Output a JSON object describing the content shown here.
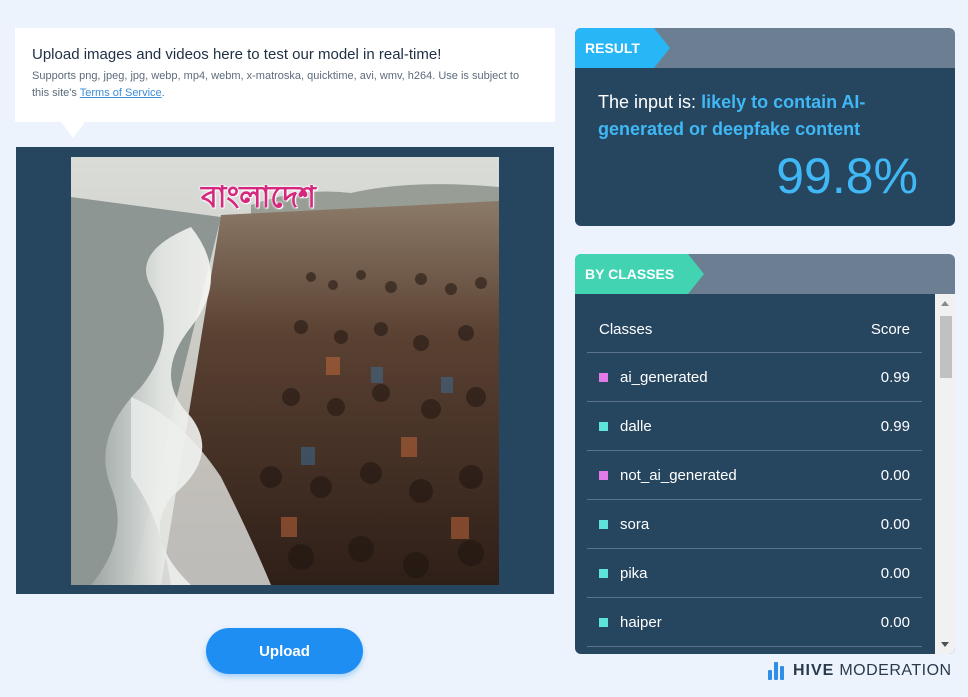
{
  "info": {
    "title": "Upload images and videos here to test our model in real-time!",
    "subtitle_prefix": "Supports png, jpeg, jpg, webp, mp4, webm, x-matroska, quicktime, avi, wmv, h264. Use is subject to this site's ",
    "tos_link": "Terms of Service",
    "subtitle_suffix": "."
  },
  "image": {
    "overlay_text": "বাংলাদেশ"
  },
  "upload_label": "Upload",
  "result": {
    "tag": "RESULT",
    "verdict_prefix": "The input is: ",
    "verdict_highlight": "likely to contain AI-generated or deepfake content",
    "percent": "99.8%"
  },
  "classes": {
    "tag": "BY CLASSES",
    "col_class": "Classes",
    "col_score": "Score",
    "rows": [
      {
        "name": "ai_generated",
        "score": "0.99",
        "color": "#e07be8"
      },
      {
        "name": "dalle",
        "score": "0.99",
        "color": "#5fe3d9"
      },
      {
        "name": "not_ai_generated",
        "score": "0.00",
        "color": "#e07be8"
      },
      {
        "name": "sora",
        "score": "0.00",
        "color": "#5fe3d9"
      },
      {
        "name": "pika",
        "score": "0.00",
        "color": "#5fe3d9"
      },
      {
        "name": "haiper",
        "score": "0.00",
        "color": "#5fe3d9"
      }
    ]
  },
  "brand": {
    "bold": "HIVE",
    "thin": "MODERATION"
  }
}
